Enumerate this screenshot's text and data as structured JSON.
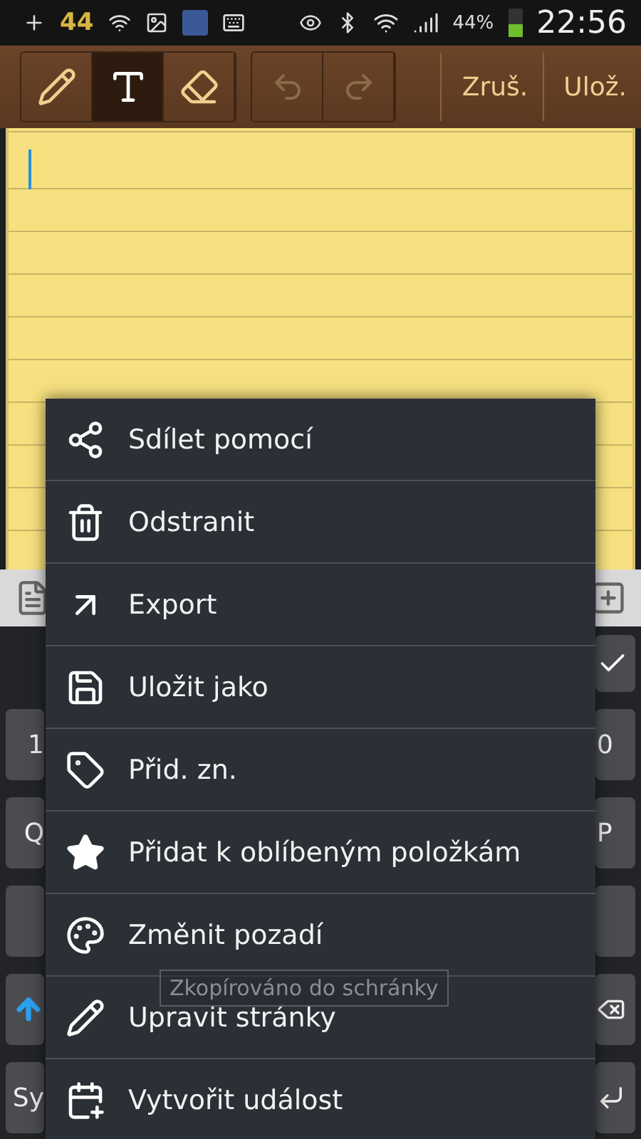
{
  "status_bar": {
    "badge_count": "44",
    "battery": "44%",
    "time": "22:56"
  },
  "toolbar": {
    "tools": [
      {
        "kind": "pen",
        "selected": false
      },
      {
        "kind": "text",
        "selected": true
      },
      {
        "kind": "eraser",
        "selected": false
      }
    ],
    "actions": [
      "Zruš.",
      "Ulož."
    ]
  },
  "menu": {
    "items": [
      {
        "kind": "share",
        "label": "Sdílet pomocí"
      },
      {
        "kind": "delete",
        "label": "Odstranit"
      },
      {
        "kind": "export",
        "label": "Export"
      },
      {
        "kind": "save",
        "label": "Uložit jako"
      },
      {
        "kind": "tag",
        "label": "Přid. zn."
      },
      {
        "kind": "star",
        "label": "Přidat k oblíbeným položkám"
      },
      {
        "kind": "palette",
        "label": "Změnit pozadí"
      },
      {
        "kind": "edit",
        "label": "Upravit stránky"
      },
      {
        "kind": "calendar",
        "label": "Vytvořit událost"
      }
    ]
  },
  "toast": "Zkopírováno do schránky",
  "keyboard": {
    "rows": [
      {
        "left": {
          "kind": "text",
          "label": "1"
        },
        "right": {
          "kind": "text",
          "label": "0"
        }
      },
      {
        "left": {
          "kind": "text",
          "label": "Q"
        },
        "right": {
          "kind": "text",
          "label": "P"
        }
      },
      {
        "left": {
          "kind": "blank"
        },
        "right": {
          "kind": "blank"
        }
      },
      {
        "left": {
          "kind": "shift"
        },
        "right": {
          "kind": "backspace"
        }
      },
      {
        "left": {
          "kind": "text",
          "label": "Sy"
        },
        "right": {
          "kind": "enter"
        }
      }
    ]
  }
}
